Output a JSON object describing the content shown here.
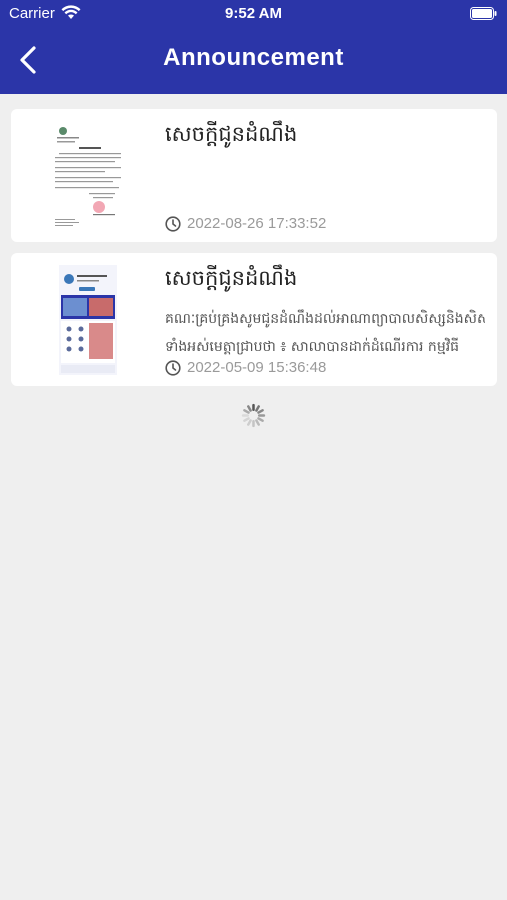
{
  "status_bar": {
    "carrier": "Carrier",
    "time": "9:52 AM"
  },
  "nav": {
    "title": "Announcement",
    "back_icon": "chevron-left-icon"
  },
  "colors": {
    "header": "#2b35a8",
    "background": "#efefef",
    "card": "#ffffff",
    "meta_text": "#9a9a9a"
  },
  "announcements": [
    {
      "title": "សេចក្ដីជូនដំណឹង",
      "description": "",
      "datetime": "2022-08-26 17:33:52",
      "thumbnail_icon": "document-letter-thumbnail"
    },
    {
      "title": "សេចក្ដីជូនដំណឹង",
      "description_line1": "គណៈគ្រប់គ្រងសូមជូនដំណឹងដល់អាណាព្យាបាលសិស្សនិងសិស្ស",
      "description_line2": "ទាំងអស់មេត្តាជ្រាបថា ៖ សាលាបានដាក់ដំណើរការ កម្មវិធី",
      "datetime": "2022-05-09 15:36:48",
      "thumbnail_icon": "app-screenshot-thumbnail"
    }
  ]
}
